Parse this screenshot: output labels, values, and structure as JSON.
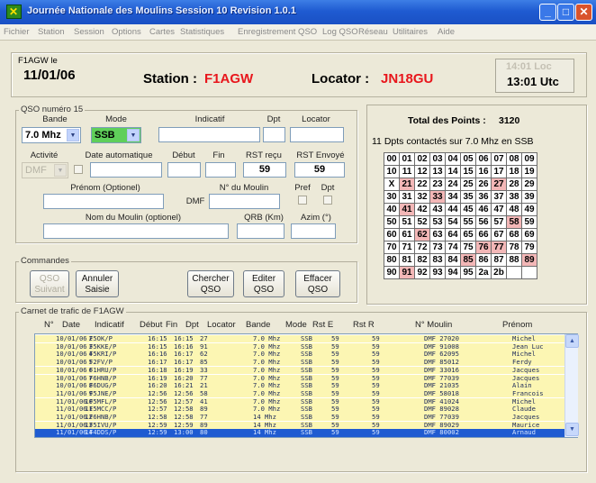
{
  "window": {
    "title": "Journée Nationale des Moulins   Session 10   Revision  1.0.1",
    "icon": "app-logo-icon"
  },
  "menu": [
    "Fichier",
    "Station",
    "Session",
    "Options",
    "Cartes",
    "Statistiques",
    "Enregistrement QSO",
    "Log QSO",
    "Réseau",
    "Utilitaires",
    "Aide"
  ],
  "header": {
    "operator_label": "F1AGW le",
    "date": "11/01/06",
    "station_label": "Station :",
    "station": "F1AGW",
    "locator_label": "Locator :",
    "locator": "JN18GU",
    "time_loc": "14:01 Loc",
    "time_utc": "13:01 Utc"
  },
  "qso": {
    "legend": "QSO numéro 15",
    "bande_label": "Bande",
    "bande": "7.0 Mhz",
    "mode_label": "Mode",
    "mode": "SSB",
    "indicatif_label": "Indicatif",
    "dpt_label": "Dpt",
    "locator_label": "Locator",
    "activite_label": "Activité",
    "activite": "DMF",
    "date_auto_label": "Date automatique",
    "debut_label": "Début",
    "fin_label": "Fin",
    "rst_recu_label": "RST reçu",
    "rst_recu": "59",
    "rst_envoye_label": "RST Envoyé",
    "rst_envoye": "59",
    "prenom_label": "Prénom (Optionel)",
    "moulin_no_label": "N° du Moulin",
    "dmf_prefix": "DMF",
    "pref_label": "Pref",
    "dpt2_label": "Dpt",
    "nom_moulin_label": "Nom du Moulin (optionel)",
    "qrb_label": "QRB (Km)",
    "azim_label": "Azim (°)"
  },
  "commandes": {
    "legend": "Commandes",
    "qso_suivant": "QSO Suivant",
    "annuler": "Annuler Saisie",
    "chercher": "Chercher QSO",
    "editer": "Editer QSO",
    "effacer": "Effacer QSO"
  },
  "points": {
    "total_label": "Total des Points :",
    "total": "3120",
    "contacted": "11 Dpts contactés sur 7.0 Mhz en SSB"
  },
  "dpt_grid": [
    [
      {
        "t": "00"
      },
      {
        "t": "01"
      },
      {
        "t": "02"
      },
      {
        "t": "03"
      },
      {
        "t": "04"
      },
      {
        "t": "05"
      },
      {
        "t": "06"
      },
      {
        "t": "07"
      },
      {
        "t": "08"
      },
      {
        "t": "09"
      }
    ],
    [
      {
        "t": "10"
      },
      {
        "t": "11"
      },
      {
        "t": "12"
      },
      {
        "t": "13"
      },
      {
        "t": "14"
      },
      {
        "t": "15"
      },
      {
        "t": "16"
      },
      {
        "t": "17"
      },
      {
        "t": "18"
      },
      {
        "t": "19"
      }
    ],
    [
      {
        "t": "X"
      },
      {
        "t": "21",
        "p": 1
      },
      {
        "t": "22"
      },
      {
        "t": "23"
      },
      {
        "t": "24"
      },
      {
        "t": "25"
      },
      {
        "t": "26"
      },
      {
        "t": "27",
        "p": 1
      },
      {
        "t": "28"
      },
      {
        "t": "29"
      }
    ],
    [
      {
        "t": "30"
      },
      {
        "t": "31"
      },
      {
        "t": "32"
      },
      {
        "t": "33",
        "p": 1
      },
      {
        "t": "34"
      },
      {
        "t": "35"
      },
      {
        "t": "36"
      },
      {
        "t": "37"
      },
      {
        "t": "38"
      },
      {
        "t": "39"
      }
    ],
    [
      {
        "t": "40"
      },
      {
        "t": "41",
        "p": 1
      },
      {
        "t": "42"
      },
      {
        "t": "43"
      },
      {
        "t": "44"
      },
      {
        "t": "45"
      },
      {
        "t": "46"
      },
      {
        "t": "47"
      },
      {
        "t": "48"
      },
      {
        "t": "49"
      }
    ],
    [
      {
        "t": "50"
      },
      {
        "t": "51"
      },
      {
        "t": "52"
      },
      {
        "t": "53"
      },
      {
        "t": "54"
      },
      {
        "t": "55"
      },
      {
        "t": "56"
      },
      {
        "t": "57"
      },
      {
        "t": "58",
        "p": 1
      },
      {
        "t": "59"
      }
    ],
    [
      {
        "t": "60"
      },
      {
        "t": "61"
      },
      {
        "t": "62",
        "p": 1
      },
      {
        "t": "63"
      },
      {
        "t": "64"
      },
      {
        "t": "65"
      },
      {
        "t": "66"
      },
      {
        "t": "67"
      },
      {
        "t": "68"
      },
      {
        "t": "69"
      }
    ],
    [
      {
        "t": "70"
      },
      {
        "t": "71"
      },
      {
        "t": "72"
      },
      {
        "t": "73"
      },
      {
        "t": "74"
      },
      {
        "t": "75"
      },
      {
        "t": "76",
        "p": 1
      },
      {
        "t": "77",
        "p": 1
      },
      {
        "t": "78"
      },
      {
        "t": "79"
      }
    ],
    [
      {
        "t": "80"
      },
      {
        "t": "81"
      },
      {
        "t": "82"
      },
      {
        "t": "83"
      },
      {
        "t": "84"
      },
      {
        "t": "85",
        "p": 1
      },
      {
        "t": "86"
      },
      {
        "t": "87"
      },
      {
        "t": "88"
      },
      {
        "t": "89",
        "p": 1
      }
    ],
    [
      {
        "t": "90"
      },
      {
        "t": "91",
        "p": 1
      },
      {
        "t": "92"
      },
      {
        "t": "93"
      },
      {
        "t": "94"
      },
      {
        "t": "95"
      },
      {
        "t": "2a"
      },
      {
        "t": "2b"
      },
      {
        "t": ""
      },
      {
        "t": ""
      }
    ]
  ],
  "log": {
    "legend": "Carnet de trafic de F1AGW",
    "headers": [
      "N°",
      "Date",
      "Indicatif",
      "Début",
      "Fin",
      "Dpt",
      "Locator",
      "Bande",
      "Mode",
      "Rst E",
      "Rst R",
      "N° Moulin",
      "Prénom"
    ],
    "rows": [
      [
        "2",
        "10/01/06",
        "F5OK/P",
        "16:15",
        "16:15",
        "27",
        "",
        "7.0 Mhz",
        "SSB",
        "59",
        "59",
        "DMF 27020",
        "Michel"
      ],
      [
        "3",
        "10/01/06",
        "F5KKE/P",
        "16:15",
        "16:16",
        "91",
        "",
        "7.0 Mhz",
        "SSB",
        "59",
        "59",
        "DMF 91008",
        "Jean Luc"
      ],
      [
        "4",
        "10/01/06",
        "F5KRI/P",
        "16:16",
        "16:17",
        "62",
        "",
        "7.0 Mhz",
        "SSB",
        "59",
        "59",
        "DMF 62095",
        "Michel"
      ],
      [
        "5",
        "10/01/06",
        "F2FV/P",
        "16:17",
        "16:17",
        "85",
        "",
        "7.0 Mhz",
        "SSB",
        "59",
        "59",
        "DMF 85012",
        "Ferdy"
      ],
      [
        "6",
        "10/01/06",
        "F1HRU/P",
        "16:18",
        "16:19",
        "33",
        "",
        "7.0 Mhz",
        "SSB",
        "59",
        "59",
        "DMF 33016",
        "Jacques"
      ],
      [
        "7",
        "10/01/06",
        "F6HNB/P",
        "16:19",
        "16:20",
        "77",
        "",
        "7.0 Mhz",
        "SSB",
        "59",
        "59",
        "DMF 77039",
        "Jacques"
      ],
      [
        "8",
        "10/01/06",
        "F6DUG/P",
        "16:20",
        "16:21",
        "21",
        "",
        "7.0 Mhz",
        "SSB",
        "59",
        "59",
        "DMF 21035",
        "Alain"
      ],
      [
        "9",
        "11/01/06",
        "F5JNE/P",
        "12:56",
        "12:56",
        "58",
        "",
        "7.0 Mhz",
        "SSB",
        "59",
        "59",
        "DMF 58018",
        "Francois"
      ],
      [
        "10",
        "11/01/06",
        "F5MFL/P",
        "12:56",
        "12:57",
        "41",
        "",
        "7.0 Mhz",
        "SSB",
        "59",
        "59",
        "DMF 41024",
        "Michel"
      ],
      [
        "11",
        "11/01/06",
        "F5MCC/P",
        "12:57",
        "12:58",
        "89",
        "",
        "7.0 Mhz",
        "SSB",
        "59",
        "59",
        "DMF 89028",
        "Claude"
      ],
      [
        "12",
        "11/01/06",
        "F6HNB/P",
        "12:58",
        "12:58",
        "77",
        "",
        "14 Mhz",
        "SSB",
        "59",
        "59",
        "DMF 77039",
        "Jacques"
      ],
      [
        "13",
        "11/01/06",
        "F5IVU/P",
        "12:59",
        "12:59",
        "89",
        "",
        "14 Mhz",
        "SSB",
        "59",
        "59",
        "DMF 89029",
        "Maurice"
      ],
      [
        "14",
        "11/01/06",
        "F4DDS/P",
        "12:59",
        "13:00",
        "80",
        "",
        "14 Mhz",
        "SSB",
        "59",
        "59",
        "DMF 80002",
        "Arnaud"
      ]
    ]
  }
}
